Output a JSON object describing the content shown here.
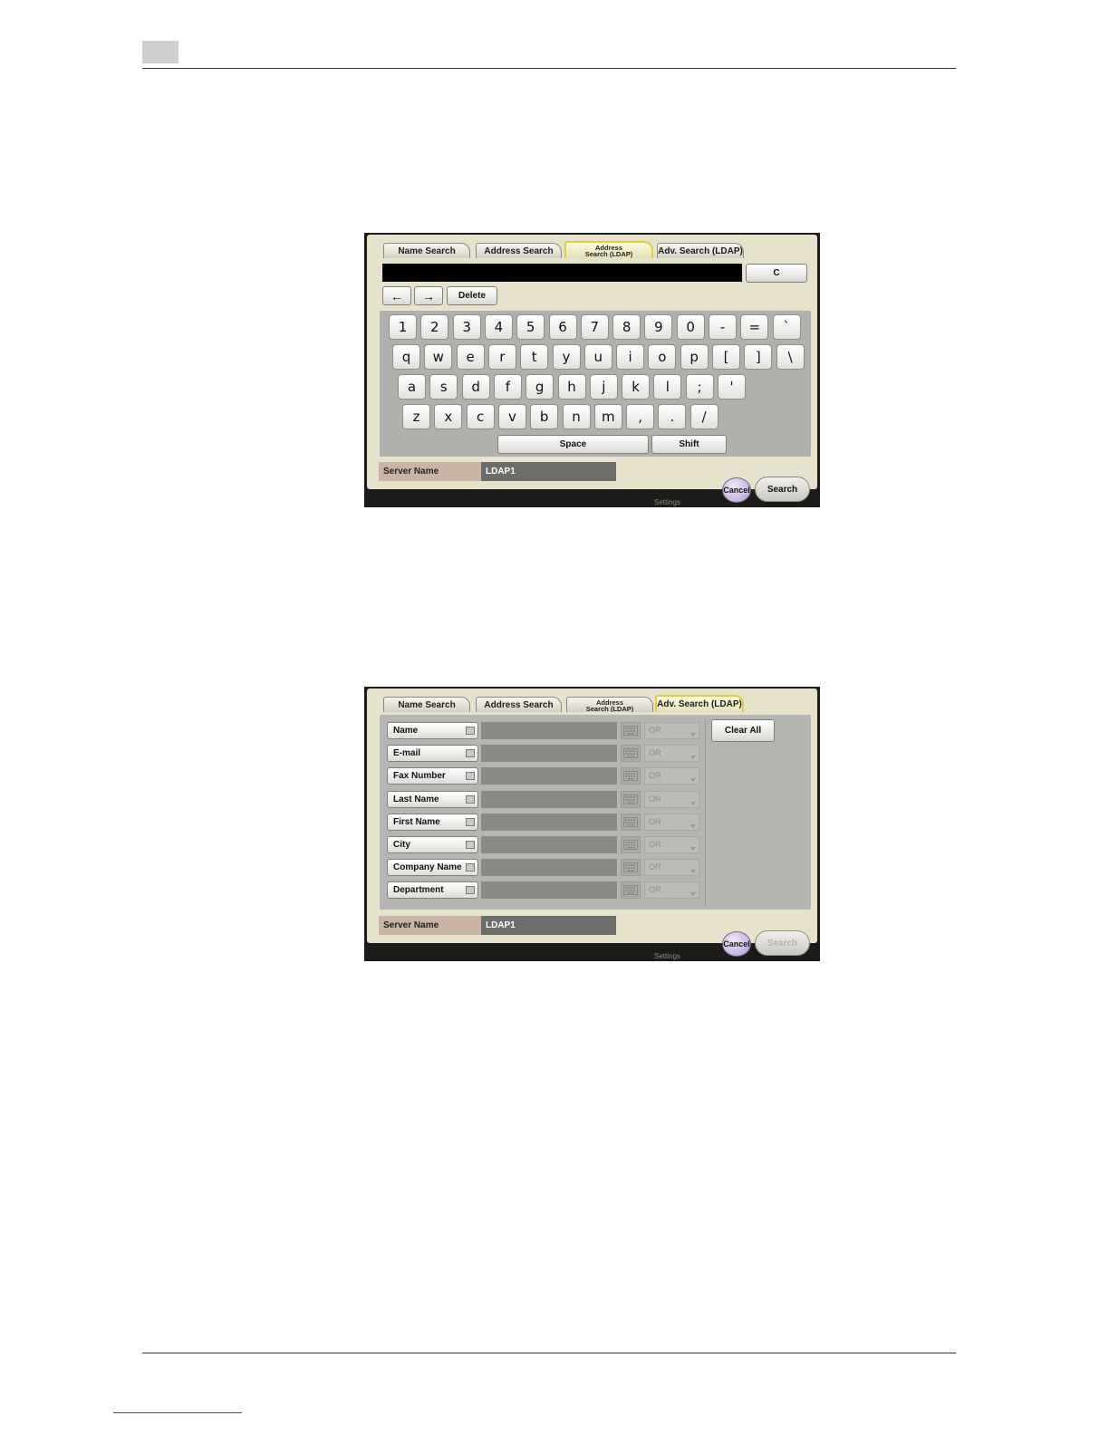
{
  "screen1": {
    "tabs": [
      "Name Search",
      "Address Search",
      "Address\nSearch (LDAP)",
      "Adv. Search (LDAP)"
    ],
    "active_tab": 2,
    "clear_label": "C",
    "back_arrow": "←",
    "forward_arrow": "→",
    "delete_label": "Delete",
    "rows": [
      [
        "1",
        "2",
        "3",
        "4",
        "5",
        "6",
        "7",
        "8",
        "9",
        "0",
        "-",
        "=",
        "`"
      ],
      [
        "q",
        "w",
        "e",
        "r",
        "t",
        "y",
        "u",
        "i",
        "o",
        "p",
        "[",
        "]",
        "\\"
      ],
      [
        "a",
        "s",
        "d",
        "f",
        "g",
        "h",
        "j",
        "k",
        "l",
        ";",
        "'"
      ],
      [
        "z",
        "x",
        "c",
        "v",
        "b",
        "n",
        "m",
        ",",
        ".",
        "/"
      ]
    ],
    "space_label": "Space",
    "shift_label": "Shift",
    "server_label": "Server Name",
    "server_value": "LDAP1",
    "cancel_label": "Cancel",
    "search_label": "Search",
    "ghost_settings": "Settings"
  },
  "screen2": {
    "tabs": [
      "Name Search",
      "Address Search",
      "Address\nSearch (LDAP)",
      "Adv. Search (LDAP)"
    ],
    "active_tab": 3,
    "fields": [
      "Name",
      "E-mail",
      "Fax Number",
      "Last Name",
      "First Name",
      "City",
      "Company Name",
      "Department"
    ],
    "operator": "OR",
    "clear_all_label": "Clear All",
    "server_label": "Server Name",
    "server_value": "LDAP1",
    "cancel_label": "Cancel",
    "search_label": "Search",
    "ghost_settings": "Settings"
  },
  "icons": {
    "keyboard": "keyboard-icon",
    "dropdown": "chevron-down-icon"
  }
}
